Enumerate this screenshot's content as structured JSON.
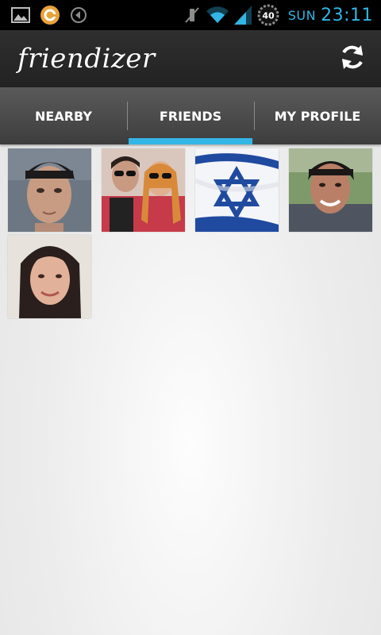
{
  "status_bar": {
    "day": "SUN",
    "time": "23:11",
    "battery": "40",
    "icons": [
      "gallery-icon",
      "app-notification-icon",
      "audio-icon",
      "mute-icon",
      "wifi-icon",
      "signal-icon",
      "battery-icon"
    ]
  },
  "app": {
    "title": "friendizer",
    "refresh_icon": "refresh-icon"
  },
  "tabs": [
    {
      "label": "NEARBY",
      "selected": false
    },
    {
      "label": "FRIENDS",
      "selected": true
    },
    {
      "label": "MY PROFILE",
      "selected": false
    }
  ],
  "friends": [
    {
      "photo": "young-man-portrait"
    },
    {
      "photo": "two-people-sunglasses"
    },
    {
      "photo": "israel-flag"
    },
    {
      "photo": "smiling-man-portrait"
    },
    {
      "photo": "young-woman-portrait"
    }
  ],
  "colors": {
    "accent": "#33b5e5",
    "action_bar": "#2a2a2a",
    "tab_bar": "#4a4a4a"
  }
}
